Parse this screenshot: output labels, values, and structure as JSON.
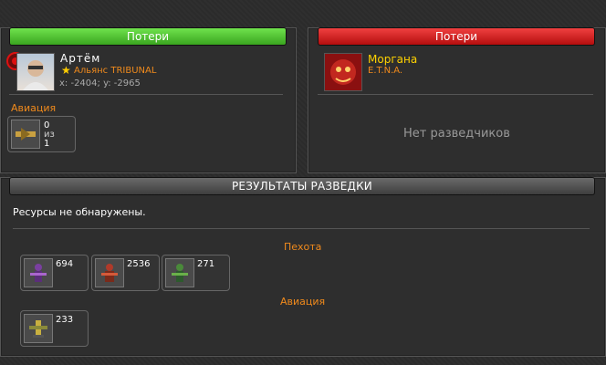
{
  "left_panel": {
    "header": "Потери",
    "player_name": "Артём",
    "alliance": "Альянс TRIBUNAL",
    "coords": "x: -2404; y: -2965",
    "section_title": "Авиация",
    "unit": {
      "count_top": "0",
      "of": "из",
      "count_bottom": "1"
    }
  },
  "right_panel": {
    "header": "Потери",
    "player_name": "Моргана",
    "alliance": "E.T.N.A.",
    "empty_message": "Нет разведчиков"
  },
  "results": {
    "header": "РЕЗУЛЬТАТЫ РАЗВЕДКИ",
    "resources_text": "Ресурсы не обнаружены.",
    "infantry_title": "Пехота",
    "infantry_units": [
      {
        "count": "694"
      },
      {
        "count": "2536"
      },
      {
        "count": "271"
      }
    ],
    "aviation_title": "Авиация",
    "aviation_units": [
      {
        "count": "233"
      }
    ]
  },
  "colors": {
    "accent_orange": "#f08a1c",
    "green_header": "#3aa51f",
    "red_header": "#b50e0e"
  }
}
